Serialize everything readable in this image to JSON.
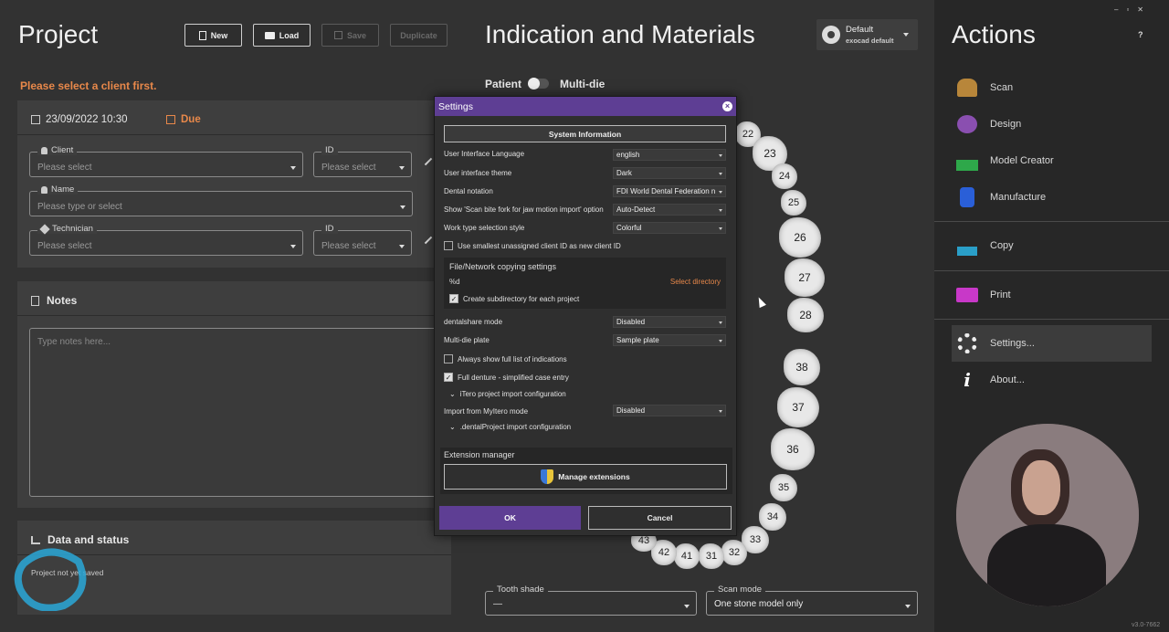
{
  "project": {
    "title": "Project",
    "buttons": {
      "new": "New",
      "load": "Load",
      "save": "Save",
      "duplicate": "Duplicate"
    },
    "warning": "Please select a client first.",
    "date": "23/09/2022 10:30",
    "due": "Due",
    "client": {
      "label": "Client",
      "placeholder": "Please select"
    },
    "client_id": {
      "label": "ID",
      "placeholder": "Please select"
    },
    "name": {
      "label": "Name",
      "placeholder": "Please type or select"
    },
    "technician": {
      "label": "Technician",
      "placeholder": "Please select"
    },
    "technician_id": {
      "label": "ID",
      "placeholder": "Please select"
    },
    "notes_title": "Notes",
    "notes_placeholder": "Type notes here...",
    "data_status_title": "Data and status",
    "data_status_text": "Project not yet saved"
  },
  "indication": {
    "title": "Indication and Materials",
    "preset_name": "Default",
    "preset_sub": "exocad default",
    "toggle_left": "Patient",
    "toggle_right": "Multi-die",
    "teeth_upper": [
      "22",
      "23",
      "24",
      "25",
      "26",
      "27",
      "28"
    ],
    "teeth_lower": [
      "38",
      "37",
      "36",
      "35",
      "34",
      "33",
      "32",
      "31",
      "41",
      "42",
      "43"
    ],
    "tooth_shade_label": "Tooth shade",
    "tooth_shade_value": "—",
    "scan_mode_label": "Scan mode",
    "scan_mode_value": "One stone model only"
  },
  "actions": {
    "title": "Actions",
    "help": "?",
    "items": [
      "Scan",
      "Design",
      "Model Creator",
      "Manufacture",
      "Copy",
      "Print",
      "Settings...",
      "About..."
    ],
    "version": "v3.0-7662"
  },
  "settings": {
    "title": "Settings",
    "system_info": "System Information",
    "rows": [
      {
        "label": "User Interface Language",
        "value": "english"
      },
      {
        "label": "User interface theme",
        "value": "Dark"
      },
      {
        "label": "Dental notation",
        "value": "FDI World Dental Federation n"
      },
      {
        "label": "Show 'Scan bite fork for jaw motion import' option",
        "value": "Auto-Detect"
      },
      {
        "label": "Work type selection style",
        "value": "Colorful"
      }
    ],
    "use_smallest_id": "Use smallest unassigned client ID as new client ID",
    "file_copy_title": "File/Network copying settings",
    "file_copy_path": "%d",
    "select_directory": "Select directory",
    "create_subdir": "Create subdirectory for each project",
    "dentalshare_label": "dentalshare mode",
    "dentalshare_value": "Disabled",
    "multidie_label": "Multi-die plate",
    "multidie_value": "Sample plate",
    "always_show": "Always show full list of indications",
    "full_denture": "Full denture - simplified case entry",
    "itero_config": "iTero project import configuration",
    "mytero_label": "Import from MyItero mode",
    "mytero_value": "Disabled",
    "dental_project_config": ".dentalProject import configuration",
    "ext_manager": "Extension manager",
    "manage_ext": "Manage extensions",
    "ok": "OK",
    "cancel": "Cancel"
  },
  "colors": {
    "accent_purple": "#5e3e94",
    "warning": "#e8884a",
    "due": "#e8884a"
  }
}
